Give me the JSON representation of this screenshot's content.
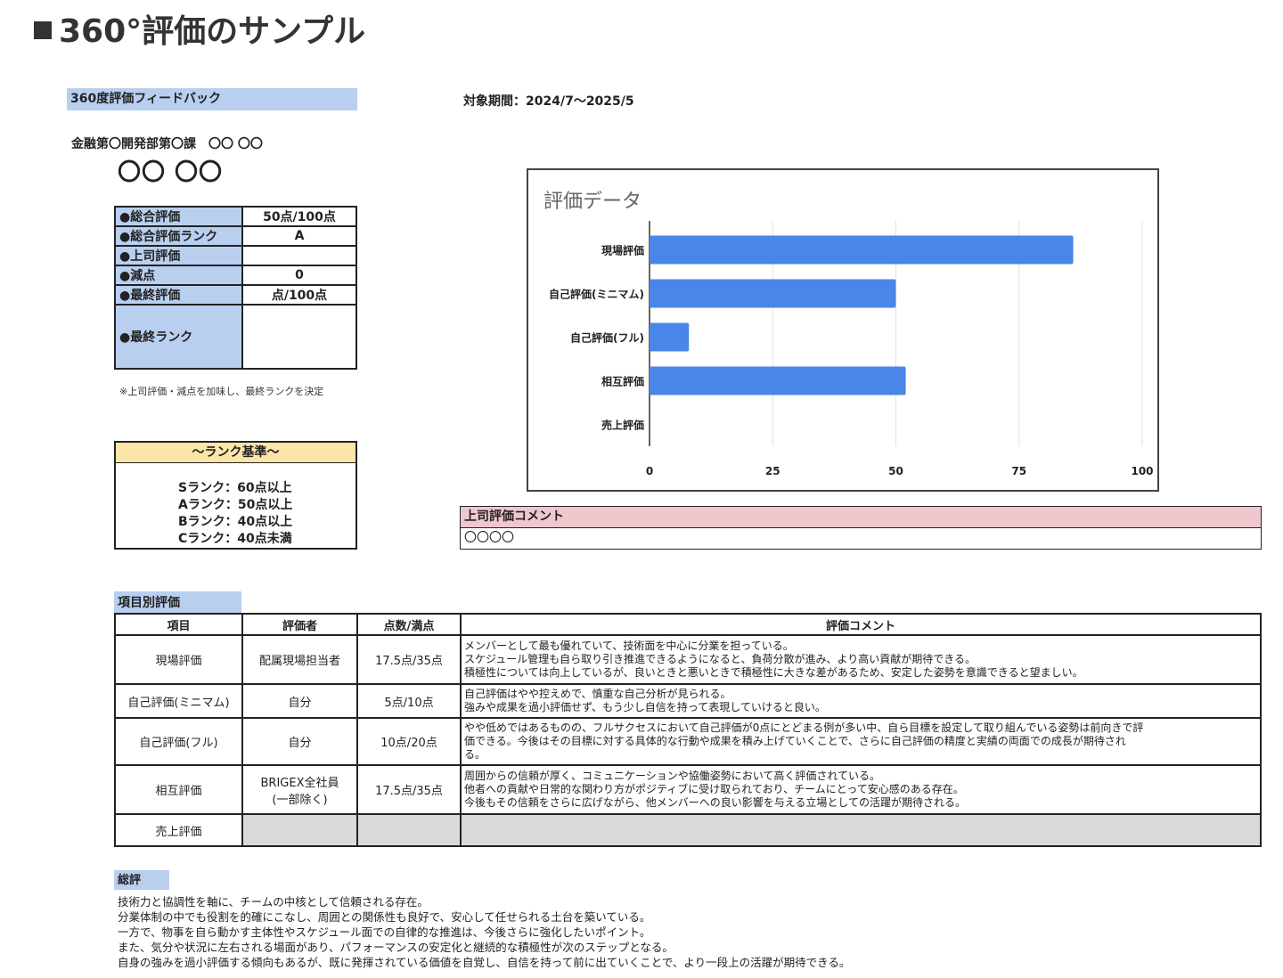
{
  "page": {
    "title": "360°評価のサンプル"
  },
  "feedback": {
    "header": "360度評価フィードバック",
    "period": "対象期間：2024/7〜2025/5",
    "department": "金融第〇開発部第〇課　〇〇 〇〇",
    "name": "〇〇 〇〇"
  },
  "summary": {
    "rows": [
      {
        "label": "●総合評価",
        "value": "50点/100点"
      },
      {
        "label": "●総合評価ランク",
        "value": "A"
      },
      {
        "label": "●上司評価",
        "value": ""
      },
      {
        "label": "●減点",
        "value": "0"
      },
      {
        "label": "●最終評価",
        "value": "点/100点"
      },
      {
        "label": "●最終ランク",
        "value": ""
      }
    ],
    "note": "※上司評価・減点を加味し、最終ランクを決定"
  },
  "rank_criteria": {
    "header": "〜ランク基準〜",
    "lines": [
      "Sランク：60点以上",
      "Aランク：50点以上",
      "Bランク：40点以上",
      "Cランク：40点未満"
    ]
  },
  "chart_data": {
    "type": "bar",
    "orientation": "horizontal",
    "title": "評価データ",
    "categories": [
      "現場評価",
      "自己評価(ミニマム)",
      "自己評価(フル)",
      "相互評価",
      "売上評価"
    ],
    "values": [
      86,
      50,
      8,
      52,
      0
    ],
    "xlim": [
      0,
      100
    ],
    "xticks": [
      "0",
      "25",
      "50",
      "75",
      "100"
    ],
    "grid": true,
    "bar_color": "#4a86e8"
  },
  "boss_comment": {
    "header": "上司評価コメント",
    "body": "〇〇〇〇"
  },
  "items": {
    "header": "項目別評価",
    "columns": [
      "項目",
      "評価者",
      "点数/満点",
      "評価コメント"
    ],
    "rows": [
      {
        "item": "現場評価",
        "evaluator": "配属現場担当者",
        "score": "17.5点/35点",
        "comment": [
          "メンバーとして最も優れていて、技術面を中心に分業を担っている。",
          "スケジュール管理も自ら取り引き推進できるようになると、負荷分散が進み、より高い貢献が期待できる。",
          "積極性については向上しているが、良いときと悪いときで積極性に大きな差があるため、安定した姿勢を意識できると望ましい。"
        ]
      },
      {
        "item": "自己評価(ミニマム)",
        "evaluator": "自分",
        "score": "5点/10点",
        "comment": [
          "自己評価はやや控えめで、慎重な自己分析が見られる。",
          "強みや成果を過小評価せず、もう少し自信を持って表現していけると良い。"
        ]
      },
      {
        "item": "自己評価(フル)",
        "evaluator": "自分",
        "score": "10点/20点",
        "comment": [
          "やや低めではあるものの、フルサクセスにおいて自己評価が0点にとどまる例が多い中、自ら目標を設定して取り組んでいる姿勢は前向きで評",
          "価できる。今後はその目標に対する具体的な行動や成果を積み上げていくことで、さらに自己評価の精度と実績の両面での成長が期待され",
          "る。"
        ]
      },
      {
        "item": "相互評価",
        "evaluator": [
          "BRIGEX全社員",
          "(一部除く)"
        ],
        "score": "17.5点/35点",
        "comment": [
          "周囲からの信頼が厚く、コミュニケーションや協働姿勢において高く評価されている。",
          "他者への貢献や日常的な関わり方がポジティブに受け取られており、チームにとって安心感のある存在。",
          "今後もその信頼をさらに広げながら、他メンバーへの良い影響を与える立場としての活躍が期待される。"
        ]
      },
      {
        "item": "売上評価",
        "evaluator": "",
        "score": "",
        "comment": []
      }
    ]
  },
  "overall": {
    "header": "総評",
    "lines": [
      "技術力と協調性を軸に、チームの中核として信頼される存在。",
      "分業体制の中でも役割を的確にこなし、周囲との関係性も良好で、安心して任せられる土台を築いている。",
      "一方で、物事を自ら動かす主体性やスケジュール面での自律的な推進は、今後さらに強化したいポイント。",
      "また、気分や状況に左右される場面があり、パフォーマンスの安定化と継続的な積極性が次のステップとなる。",
      "自身の強みを過小評価する傾向もあるが、既に発揮されている価値を自覚し、自信を持って前に出ていくことで、より一段上の活躍が期待できる。"
    ]
  }
}
